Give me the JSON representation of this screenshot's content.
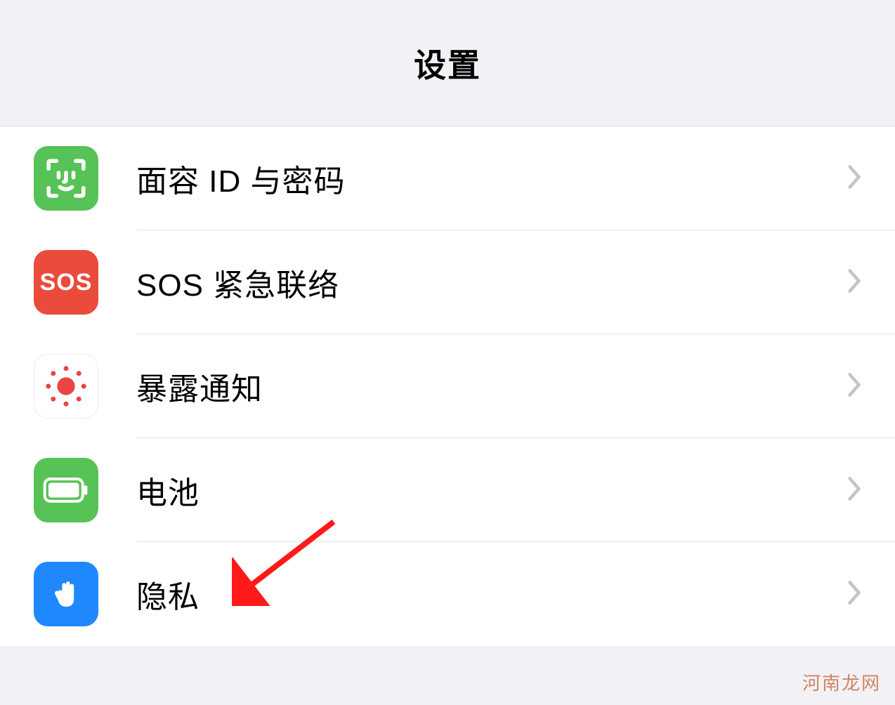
{
  "header": {
    "title": "设置"
  },
  "rows": {
    "faceid": {
      "label": "面容 ID 与密码",
      "icon": "face-id-icon"
    },
    "sos": {
      "label": "SOS 紧急联络",
      "icon": "sos-icon",
      "icon_text": "SOS"
    },
    "exposure": {
      "label": "暴露通知",
      "icon": "exposure-icon"
    },
    "battery": {
      "label": "电池",
      "icon": "battery-icon"
    },
    "privacy": {
      "label": "隐私",
      "icon": "privacy-icon"
    }
  },
  "colors": {
    "green": "#57c255",
    "red": "#ea4b3b",
    "blue": "#1f88ff",
    "chevron": "#c5c5c9",
    "arrow": "#ff1a1a"
  },
  "watermark": "河南龙网"
}
